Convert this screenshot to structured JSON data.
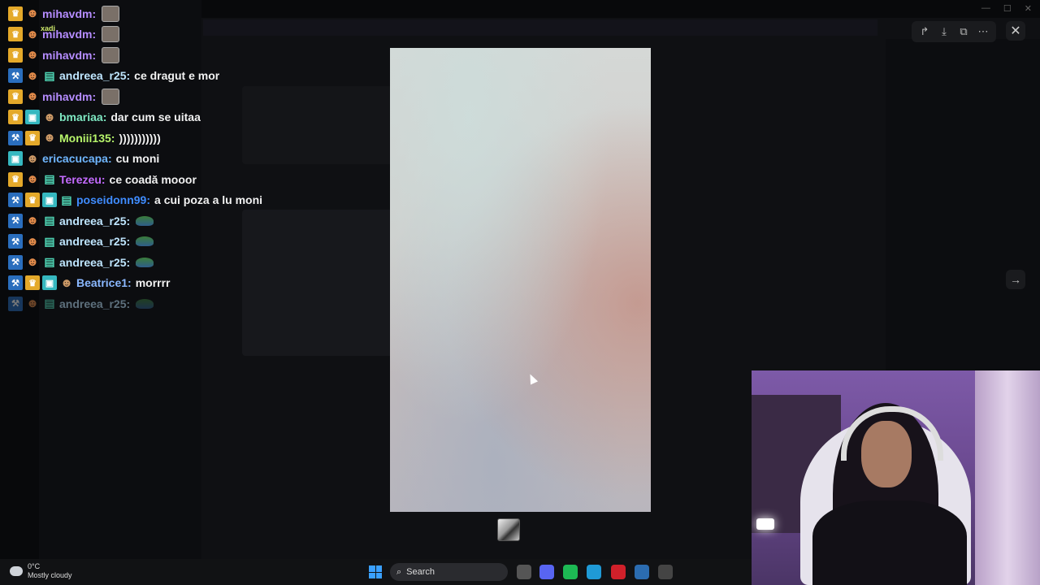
{
  "chat": {
    "messages": [
      {
        "badges": [
          "crown",
          "cat"
        ],
        "user": "mihavdm:",
        "user_color": "#b58cff",
        "text": "",
        "emote": "face"
      },
      {
        "badges": [
          "crown",
          "cat"
        ],
        "user": "mihavdm:",
        "user_color": "#b58cff",
        "text": "",
        "emote": "face",
        "overlay_name": "xadi"
      },
      {
        "badges": [
          "crown",
          "cat"
        ],
        "user": "mihavdm:",
        "user_color": "#b58cff",
        "text": "",
        "emote": "face"
      },
      {
        "badges": [
          "mod",
          "cat",
          "bag"
        ],
        "user": "andreea_r25:",
        "user_color": "#bfe6ff",
        "text": "ce dragut e mor",
        "emote": ""
      },
      {
        "badges": [
          "crown",
          "cat"
        ],
        "user": "mihavdm:",
        "user_color": "#b58cff",
        "text": "",
        "emote": "face"
      },
      {
        "badges": [
          "crown",
          "gift",
          "chicken"
        ],
        "user": "bmariaa:",
        "user_color": "#7ee8c2",
        "text": "dar cum se uitaa",
        "emote": ""
      },
      {
        "badges": [
          "mod",
          "crown",
          "chicken"
        ],
        "user": "Moniii135:",
        "user_color": "#b7f56b",
        "text": ")))))))))))",
        "emote": ""
      },
      {
        "badges": [
          "gift",
          "chicken"
        ],
        "user": "ericacucapa:",
        "user_color": "#6fb6ff",
        "text": "cu moni",
        "emote": ""
      },
      {
        "badges": [
          "crown",
          "cat",
          "bag"
        ],
        "user": "Terezeu:",
        "user_color": "#c46bff",
        "text": "ce coadă mooor",
        "emote": ""
      },
      {
        "badges": [
          "mod",
          "crown",
          "gift",
          "bag"
        ],
        "user": "poseidonn99:",
        "user_color": "#3f8cff",
        "text": "a cui poza a lu moni",
        "emote": ""
      },
      {
        "badges": [
          "mod",
          "cat",
          "bag"
        ],
        "user": "andreea_r25:",
        "user_color": "#bfe6ff",
        "text": "",
        "emote": "turtle"
      },
      {
        "badges": [
          "mod",
          "cat",
          "bag"
        ],
        "user": "andreea_r25:",
        "user_color": "#bfe6ff",
        "text": "",
        "emote": "turtle"
      },
      {
        "badges": [
          "mod",
          "cat",
          "bag"
        ],
        "user": "andreea_r25:",
        "user_color": "#bfe6ff",
        "text": "",
        "emote": "turtle"
      },
      {
        "badges": [
          "mod",
          "crown",
          "gift",
          "chicken"
        ],
        "user": "Beatrice1:",
        "user_color": "#8ab8ff",
        "text": "morrrr",
        "emote": ""
      },
      {
        "badges": [
          "mod",
          "cat",
          "bag"
        ],
        "user": "andreea_r25:",
        "user_color": "#bfe6ff",
        "text": "",
        "emote": "turtle",
        "faded": true
      }
    ]
  },
  "viewer": {
    "actions": [
      "share-icon",
      "download-icon",
      "open-external-icon",
      "more-icon"
    ],
    "close_glyph": "✕",
    "next_glyph": "→"
  },
  "taskbar": {
    "weather_temp": "0°C",
    "weather_desc": "Mostly cloudy",
    "search_label": "Search",
    "apps": [
      {
        "name": "task-view-icon",
        "color": "#555"
      },
      {
        "name": "discord-icon",
        "color": "#5865f2"
      },
      {
        "name": "spotify-icon",
        "color": "#1db954"
      },
      {
        "name": "edge-icon",
        "color": "#1f9ad6"
      },
      {
        "name": "app-red-icon",
        "color": "#d0202a"
      },
      {
        "name": "store-icon",
        "color": "#2b6cb0"
      },
      {
        "name": "obs-icon",
        "color": "#444"
      }
    ]
  }
}
